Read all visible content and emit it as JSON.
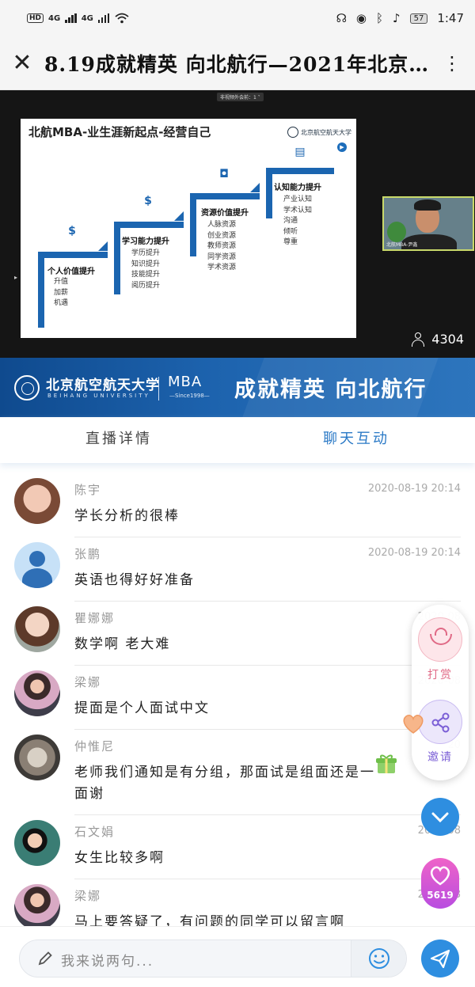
{
  "status_bar": {
    "hd": "HD",
    "net1": "4G",
    "net2": "4G",
    "battery": "57",
    "time": "1:47"
  },
  "title_bar": {
    "title": "8.19成就精英 向北航行—2021年北京…",
    "close_icon": "close-icon",
    "more_icon": "more-icon"
  },
  "video": {
    "top_label": "非视频外会前：1 ˅",
    "slide": {
      "title": "北航MBA-业生涯新起点-经营自己",
      "logo_text": "北京航空航天大学",
      "steps": [
        {
          "heading": "个人价值提升",
          "items": [
            "升值",
            "加薪",
            "机遇"
          ]
        },
        {
          "heading": "学习能力提升",
          "items": [
            "学历提升",
            "知识提升",
            "技能提升",
            "阅历提升"
          ]
        },
        {
          "heading": "资源价值提升",
          "items": [
            "人脉资源",
            "创业资源",
            "教师资源",
            "同学资源",
            "学术资源"
          ]
        },
        {
          "heading": "认知能力提升",
          "items": [
            "产业认知",
            "学术认知",
            "沟通",
            "倾听",
            "尊重"
          ]
        }
      ]
    },
    "camera_label": "北航MBA-尹鑫",
    "viewer_count": "4304"
  },
  "banner": {
    "university": "北京航空航天大学",
    "university_en": "BEIHANG UNIVERSITY",
    "mba": "MBA",
    "since": "—Since1998—",
    "slogan": "成就精英 向北航行"
  },
  "tabs": [
    {
      "label": "直播详情",
      "active": false
    },
    {
      "label": "聊天互动",
      "active": true
    }
  ],
  "chat": [
    {
      "name": "陈宇",
      "time": "2020-08-19 20:14",
      "message": "学长分析的很棒"
    },
    {
      "name": "张鹏",
      "time": "2020-08-19 20:14",
      "message": "英语也得好好准备"
    },
    {
      "name": "瞿娜娜",
      "time": "2020-08",
      "message": "数学啊 老大难"
    },
    {
      "name": "梁娜",
      "time": "2020-08",
      "message": "提面是个人面试中文"
    },
    {
      "name": "仲惟尼",
      "time": "20",
      "message": "老师我们通知是有分组，那面试是组面还是一面谢"
    },
    {
      "name": "石文娟",
      "time": "2020-08",
      "message": "女生比较多啊"
    },
    {
      "name": "梁娜",
      "time": "2020-08",
      "message": "马上要答疑了，有问题的同学可以留言啊"
    }
  ],
  "actions": {
    "reward_label": "打赏",
    "invite_label": "邀请",
    "like_count": "5619"
  },
  "input": {
    "placeholder": "我来说两句..."
  },
  "colors": {
    "accent": "#2a79c6",
    "banner_blue": "#1d63ae",
    "reward_pink": "#e06a86",
    "invite_purple": "#7b5fd6"
  }
}
